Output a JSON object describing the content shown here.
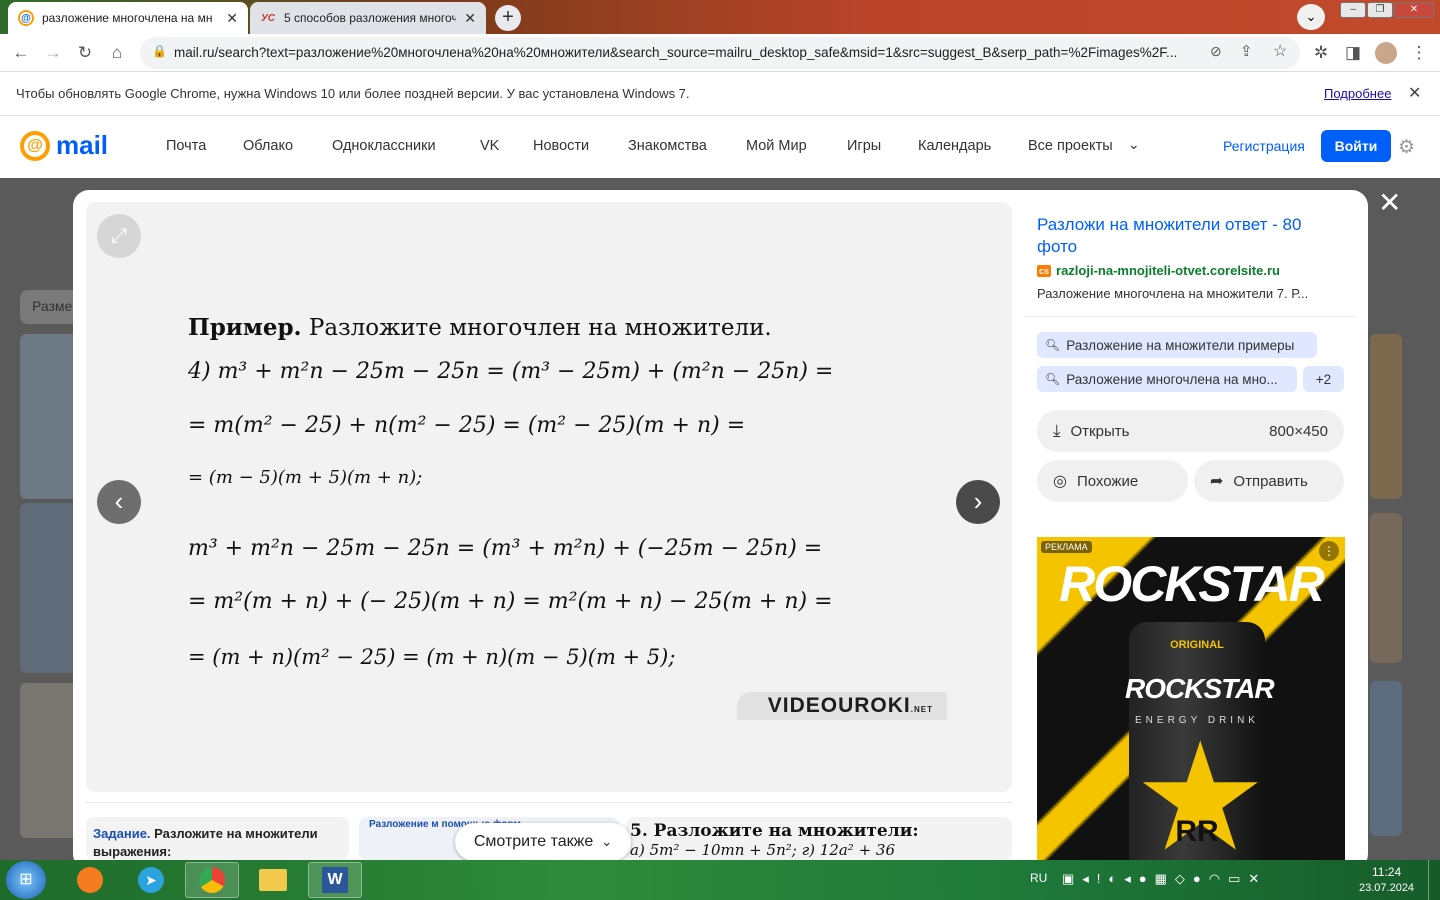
{
  "browser": {
    "tabs": [
      {
        "title": "разложение многочлена на мн",
        "favicon": "@",
        "active": true
      },
      {
        "title": "5 способов разложения многоч",
        "favicon": "УС",
        "active": false
      }
    ],
    "url": "mail.ru/search?text=разложение%20многочлена%20на%20множители&search_source=mailru_desktop_safe&msid=1&src=suggest_B&serp_path=%2Fimages%2F..."
  },
  "infobar": {
    "message": "Чтобы обновлять Google Chrome, нужна Windows 10 или более поздней версии. У вас установлена Windows 7.",
    "link": "Подробнее"
  },
  "mail": {
    "logo": "mail",
    "nav": [
      "Почта",
      "Облако",
      "Одноклассники",
      "VK",
      "Новости",
      "Знакомства",
      "Мой Мир",
      "Игры",
      "Календарь",
      "Все проекты"
    ],
    "register": "Регистрация",
    "login": "Войти"
  },
  "background": {
    "search_value": "Разме"
  },
  "image": {
    "heading_bold": "Пример.",
    "heading_rest": "Разложите многочлен на множители.",
    "lines": [
      "4) m³ + m²n − 25m − 25n = (m³ − 25m) + (m²n − 25n) =",
      "= m(m² − 25) + n(m² − 25) = (m² − 25)(m + n) =",
      "= (m − 5)(m + 5)(m + n);",
      "m³ + m²n − 25m − 25n = (m³ + m²n) + (−25m − 25n) =",
      "= m²(m + n) + (− 25)(m + n) = m²(m + n) − 25(m + n) =",
      "= (m + n)(m² − 25) = (m + n)(m − 5)(m + 5);"
    ],
    "watermark": "VIDEOUROKI",
    "watermark_suffix": ".NET"
  },
  "panel": {
    "title": "Разложи на множители ответ - 80 фото",
    "source_badge": "cs",
    "source": "razloji-na-mnojiteli-otvet.corelsite.ru",
    "description": "Разложение многочлена на множители 7. Р...",
    "chips": [
      "Разложение на множители примеры",
      "Разложение многочлена на мно..."
    ],
    "chips_more": "+2",
    "open_label": "Открыть",
    "size": "800×450",
    "similar_label": "Похожие",
    "share_label": "Отправить"
  },
  "ad": {
    "badge": "РЕКЛАМА",
    "brand": "ROCKSTAR",
    "can_top": "ORIGINAL",
    "can_brand": "ROCKSTAR",
    "can_sub": "ENERGY DRINK",
    "can_rr": "RR"
  },
  "bottom": {
    "card1_bold": "Задание.",
    "card1_rest": " Разложите на множители выражения:",
    "card2": "Разложение м помощью форм",
    "see_also": "Смотрите также",
    "card4": "5. Разложите на множители:",
    "card4_line": "а) 5m² − 10mn + 5n²;        г) 12a² + 36"
  },
  "taskbar": {
    "lang": "RU",
    "time": "11:24",
    "date": "23.07.2024"
  },
  "colors": {
    "mail_blue": "#005ff9",
    "mail_orange": "#ff9e00",
    "overlay": "#5a5a5a"
  }
}
